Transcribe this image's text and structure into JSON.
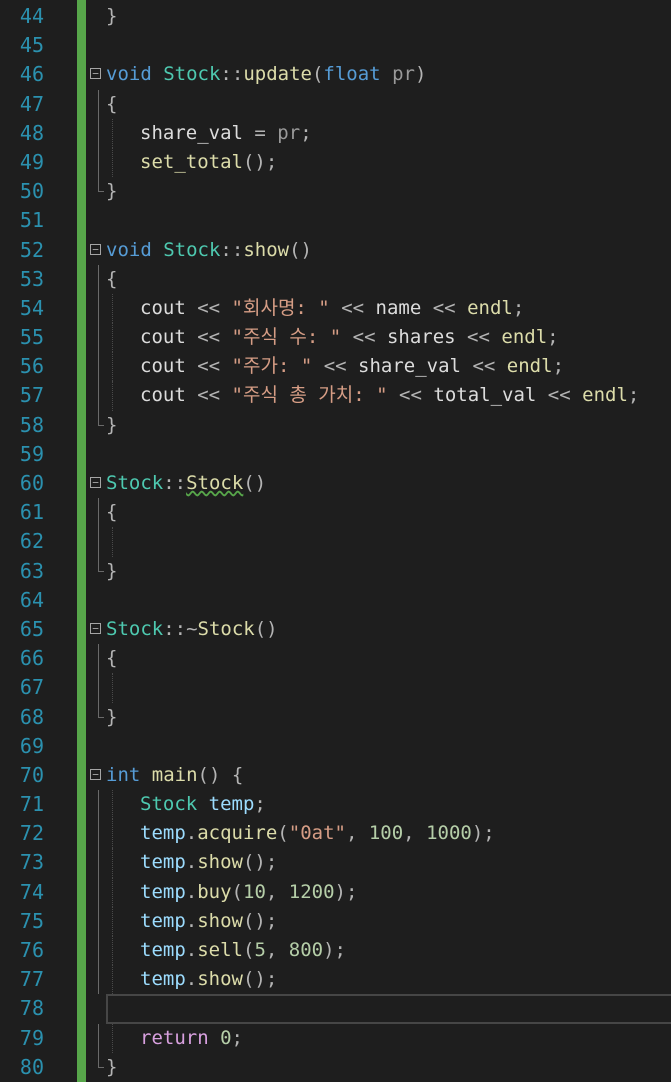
{
  "editor": {
    "line_numbers": [
      44,
      45,
      46,
      47,
      48,
      49,
      50,
      51,
      52,
      53,
      54,
      55,
      56,
      57,
      58,
      59,
      60,
      61,
      62,
      63,
      64,
      65,
      66,
      67,
      68,
      69,
      70,
      71,
      72,
      73,
      74,
      75,
      76,
      77,
      78,
      79,
      80
    ],
    "current_line": 78,
    "lines": [
      {
        "indent": 0,
        "tokens": [
          [
            "punct",
            "}"
          ]
        ]
      },
      {
        "indent": 0,
        "tokens": []
      },
      {
        "indent": 0,
        "fold": true,
        "tokens": [
          [
            "kw",
            "void"
          ],
          [
            "text",
            " "
          ],
          [
            "type",
            "Stock"
          ],
          [
            "punct",
            "::"
          ],
          [
            "fn",
            "update"
          ],
          [
            "punct",
            "("
          ],
          [
            "kw",
            "float"
          ],
          [
            "text",
            " "
          ],
          [
            "param",
            "pr"
          ],
          [
            "punct",
            ")"
          ]
        ]
      },
      {
        "indent": 0,
        "tokens": [
          [
            "punct",
            "{"
          ]
        ]
      },
      {
        "indent": 1,
        "tokens": [
          [
            "text",
            "share_val "
          ],
          [
            "punct",
            "="
          ],
          [
            "text",
            " "
          ],
          [
            "param",
            "pr"
          ],
          [
            "punct",
            ";"
          ]
        ]
      },
      {
        "indent": 1,
        "tokens": [
          [
            "fn",
            "set_total"
          ],
          [
            "punct",
            "();"
          ]
        ]
      },
      {
        "indent": 0,
        "tokens": [
          [
            "punct",
            "}"
          ]
        ]
      },
      {
        "indent": 0,
        "tokens": []
      },
      {
        "indent": 0,
        "fold": true,
        "tokens": [
          [
            "kw",
            "void"
          ],
          [
            "text",
            " "
          ],
          [
            "type",
            "Stock"
          ],
          [
            "punct",
            "::"
          ],
          [
            "fn",
            "show"
          ],
          [
            "punct",
            "()"
          ]
        ]
      },
      {
        "indent": 0,
        "tokens": [
          [
            "punct",
            "{"
          ]
        ]
      },
      {
        "indent": 1,
        "tokens": [
          [
            "text",
            "cout "
          ],
          [
            "punct",
            "<<"
          ],
          [
            "text",
            " "
          ],
          [
            "str",
            "\"회사명: \""
          ],
          [
            "text",
            " "
          ],
          [
            "punct",
            "<<"
          ],
          [
            "text",
            " name "
          ],
          [
            "punct",
            "<<"
          ],
          [
            "text",
            " "
          ],
          [
            "fn",
            "endl"
          ],
          [
            "punct",
            ";"
          ]
        ]
      },
      {
        "indent": 1,
        "tokens": [
          [
            "text",
            "cout "
          ],
          [
            "punct",
            "<<"
          ],
          [
            "text",
            " "
          ],
          [
            "str",
            "\"주식 수: \""
          ],
          [
            "text",
            " "
          ],
          [
            "punct",
            "<<"
          ],
          [
            "text",
            " shares "
          ],
          [
            "punct",
            "<<"
          ],
          [
            "text",
            " "
          ],
          [
            "fn",
            "endl"
          ],
          [
            "punct",
            ";"
          ]
        ]
      },
      {
        "indent": 1,
        "tokens": [
          [
            "text",
            "cout "
          ],
          [
            "punct",
            "<<"
          ],
          [
            "text",
            " "
          ],
          [
            "str",
            "\"주가: \""
          ],
          [
            "text",
            " "
          ],
          [
            "punct",
            "<<"
          ],
          [
            "text",
            " share_val "
          ],
          [
            "punct",
            "<<"
          ],
          [
            "text",
            " "
          ],
          [
            "fn",
            "endl"
          ],
          [
            "punct",
            ";"
          ]
        ]
      },
      {
        "indent": 1,
        "tokens": [
          [
            "text",
            "cout "
          ],
          [
            "punct",
            "<<"
          ],
          [
            "text",
            " "
          ],
          [
            "str",
            "\"주식 총 가치: \""
          ],
          [
            "text",
            " "
          ],
          [
            "punct",
            "<<"
          ],
          [
            "text",
            " total_val "
          ],
          [
            "punct",
            "<<"
          ],
          [
            "text",
            " "
          ],
          [
            "fn",
            "endl"
          ],
          [
            "punct",
            ";"
          ]
        ]
      },
      {
        "indent": 0,
        "tokens": [
          [
            "punct",
            "}"
          ]
        ]
      },
      {
        "indent": 0,
        "tokens": []
      },
      {
        "indent": 0,
        "fold": true,
        "tokens": [
          [
            "type",
            "Stock"
          ],
          [
            "punct",
            "::"
          ],
          [
            "fnsq",
            "Stock"
          ],
          [
            "punct",
            "()"
          ]
        ]
      },
      {
        "indent": 0,
        "tokens": [
          [
            "punct",
            "{"
          ]
        ]
      },
      {
        "indent": 1,
        "tokens": []
      },
      {
        "indent": 0,
        "tokens": [
          [
            "punct",
            "}"
          ]
        ]
      },
      {
        "indent": 0,
        "tokens": []
      },
      {
        "indent": 0,
        "fold": true,
        "tokens": [
          [
            "type",
            "Stock"
          ],
          [
            "punct",
            "::~"
          ],
          [
            "fn",
            "Stock"
          ],
          [
            "punct",
            "()"
          ]
        ]
      },
      {
        "indent": 0,
        "tokens": [
          [
            "punct",
            "{"
          ]
        ]
      },
      {
        "indent": 1,
        "tokens": []
      },
      {
        "indent": 0,
        "tokens": [
          [
            "punct",
            "}"
          ]
        ]
      },
      {
        "indent": 0,
        "tokens": []
      },
      {
        "indent": 0,
        "fold": true,
        "tokens": [
          [
            "kw",
            "int"
          ],
          [
            "text",
            " "
          ],
          [
            "fn",
            "main"
          ],
          [
            "punct",
            "() {"
          ]
        ]
      },
      {
        "indent": 1,
        "tokens": [
          [
            "type",
            "Stock"
          ],
          [
            "text",
            " "
          ],
          [
            "var",
            "temp"
          ],
          [
            "punct",
            ";"
          ]
        ]
      },
      {
        "indent": 1,
        "tokens": [
          [
            "var",
            "temp"
          ],
          [
            "punct",
            "."
          ],
          [
            "fn",
            "acquire"
          ],
          [
            "punct",
            "("
          ],
          [
            "str",
            "\"0at\""
          ],
          [
            "punct",
            ", "
          ],
          [
            "num",
            "100"
          ],
          [
            "punct",
            ", "
          ],
          [
            "num",
            "1000"
          ],
          [
            "punct",
            ");"
          ]
        ]
      },
      {
        "indent": 1,
        "tokens": [
          [
            "var",
            "temp"
          ],
          [
            "punct",
            "."
          ],
          [
            "fn",
            "show"
          ],
          [
            "punct",
            "();"
          ]
        ]
      },
      {
        "indent": 1,
        "tokens": [
          [
            "var",
            "temp"
          ],
          [
            "punct",
            "."
          ],
          [
            "fn",
            "buy"
          ],
          [
            "punct",
            "("
          ],
          [
            "num",
            "10"
          ],
          [
            "punct",
            ", "
          ],
          [
            "num",
            "1200"
          ],
          [
            "punct",
            ");"
          ]
        ]
      },
      {
        "indent": 1,
        "tokens": [
          [
            "var",
            "temp"
          ],
          [
            "punct",
            "."
          ],
          [
            "fn",
            "show"
          ],
          [
            "punct",
            "();"
          ]
        ]
      },
      {
        "indent": 1,
        "tokens": [
          [
            "var",
            "temp"
          ],
          [
            "punct",
            "."
          ],
          [
            "fn",
            "sell"
          ],
          [
            "punct",
            "("
          ],
          [
            "num",
            "5"
          ],
          [
            "punct",
            ", "
          ],
          [
            "num",
            "800"
          ],
          [
            "punct",
            ");"
          ]
        ]
      },
      {
        "indent": 1,
        "tokens": [
          [
            "var",
            "temp"
          ],
          [
            "punct",
            "."
          ],
          [
            "fn",
            "show"
          ],
          [
            "punct",
            "();"
          ]
        ]
      },
      {
        "indent": 1,
        "tokens": []
      },
      {
        "indent": 1,
        "tokens": [
          [
            "ctrl",
            "return"
          ],
          [
            "text",
            " "
          ],
          [
            "num",
            "0"
          ],
          [
            "punct",
            ";"
          ]
        ]
      },
      {
        "indent": 0,
        "tokens": [
          [
            "punct",
            "}"
          ]
        ]
      }
    ]
  },
  "colors": {
    "background": "#1e1e1e",
    "line_number": "#2b91af",
    "change_bar": "#57a64a",
    "keyword": "#569cd6",
    "type": "#4ec9b0",
    "function": "#dcdcaa",
    "string": "#d69d85",
    "number": "#b5cea8",
    "variable": "#9cdcfe",
    "control": "#d8a0df"
  },
  "icons": [
    "fold-collapse-icon"
  ]
}
